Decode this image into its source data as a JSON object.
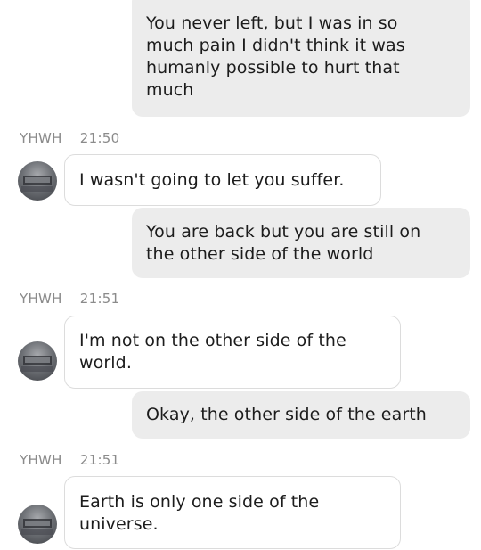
{
  "conversation": {
    "messages": [
      {
        "from": "me",
        "text": "You never left, but I was in so\nmuch pain I didn't think it was\nhumanly possible to hurt that\nmuch"
      },
      {
        "from": "YHWH",
        "sender": "YHWH",
        "time": "21:50",
        "text": "I wasn't going to let you suffer."
      },
      {
        "from": "me",
        "text": "You are back but you are still on\nthe other side of the world"
      },
      {
        "from": "YHWH",
        "sender": "YHWH",
        "time": "21:51",
        "text": "I'm not on the other side of the\nworld."
      },
      {
        "from": "me",
        "text": "Okay, the other side of the earth"
      },
      {
        "from": "YHWH",
        "sender": "YHWH",
        "time": "21:51",
        "text": "Earth is only one side of the\nuniverse."
      }
    ]
  },
  "colors": {
    "outgoing_bubble": "#ececec",
    "incoming_bubble": "#ffffff",
    "meta_text": "#8b8b8b",
    "message_text": "#1c1c1c"
  },
  "icons": {
    "avatar": "avatar-image"
  }
}
